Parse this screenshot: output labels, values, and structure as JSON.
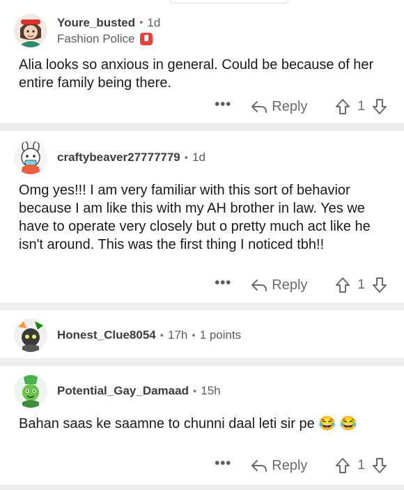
{
  "comments": [
    {
      "username": "Youre_busted",
      "time": "1d",
      "flair": "Fashion Police",
      "body": "Alia looks so anxious in general. Could be because of her entire family being there.",
      "reply_label": "Reply",
      "votes": "1",
      "more": "•••"
    },
    {
      "username": "craftybeaver27777779",
      "time": "1d",
      "body": "Omg yes!!! I am very familiar with this sort of behavior because I am like this with my AH brother in law. Yes we have to operate very closely but o pretty much act like he isn't around. This was the first thing I noticed tbh!!",
      "reply_label": "Reply",
      "votes": "1",
      "more": "•••"
    },
    {
      "username": "Honest_Clue8054",
      "time": "17h",
      "points": "1 points"
    },
    {
      "username": "Potential_Gay_Damaad",
      "time": "15h",
      "body": "Bahan saas ke saamne to chunni daal leti sir pe 😂 😂",
      "reply_label": "Reply",
      "votes": "1",
      "more": "•••"
    }
  ],
  "separator": "•",
  "colors": {
    "divider": "#ededed",
    "flair_badge": "#e8423c",
    "username": "#3c3c3c",
    "meta": "#5c5c5c"
  },
  "icons": [
    "reply-arrow-icon",
    "upvote-arrow-icon",
    "downvote-arrow-icon",
    "more-options-icon",
    "police-badge-icon"
  ]
}
